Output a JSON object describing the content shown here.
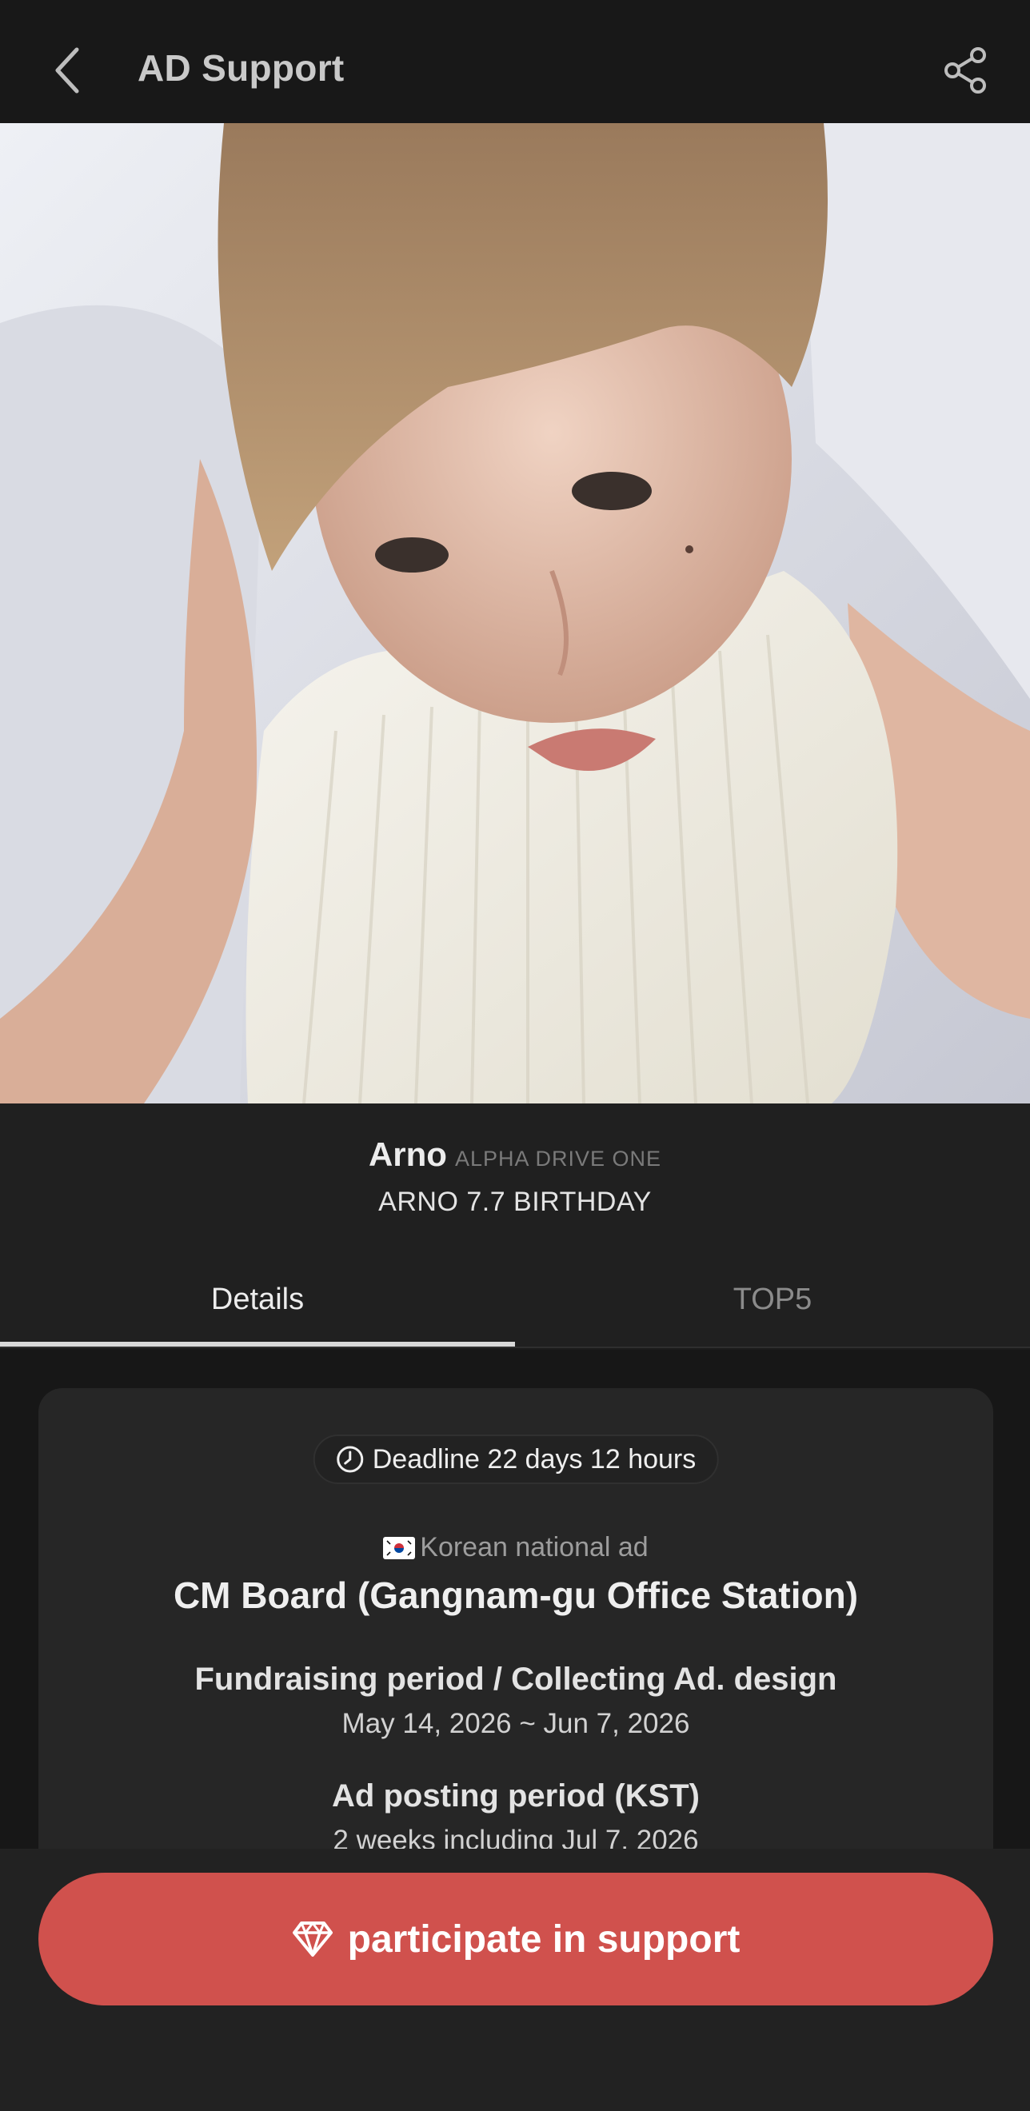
{
  "header": {
    "title": "AD Support",
    "back_icon": "chevron-left-icon",
    "share_icon": "share-icon"
  },
  "hero": {
    "image_description_icon": "photo"
  },
  "artist": {
    "name": "Arno",
    "group": "ALPHA DRIVE ONE",
    "event": "ARNO 7.7 BIRTHDAY"
  },
  "tabs": [
    {
      "label": "Details",
      "active": true
    },
    {
      "label": "TOP5",
      "active": false
    }
  ],
  "card": {
    "deadline": "Deadline 22 days 12 hours",
    "ad_type": "Korean national ad",
    "ad_title": "CM Board (Gangnam-gu Office Station)",
    "fundraising_label": "Fundraising period / Collecting Ad. design",
    "fundraising_value": "May 14, 2026 ~ Jun 7, 2026",
    "posting_label": "Ad posting period (KST)",
    "posting_value": "2 weeks including Jul 7, 2026"
  },
  "cta": {
    "label": "participate in support",
    "icon": "diamond-icon"
  },
  "colors": {
    "accent": "#d0514d",
    "background": "#1b1b1b",
    "card": "#262626"
  }
}
